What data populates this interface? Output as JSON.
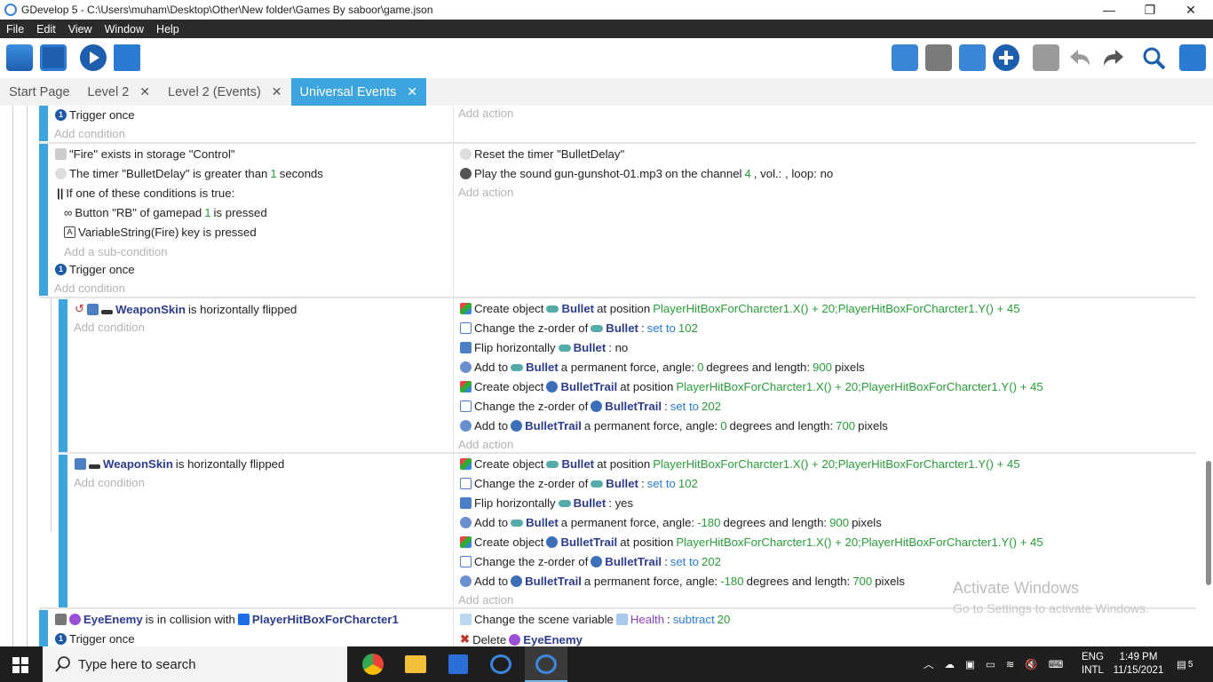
{
  "window": {
    "title": "GDevelop 5 - C:\\Users\\muham\\Desktop\\Other\\New folder\\Games By saboor\\game.json",
    "minimize": "—",
    "restore": "❐",
    "close": "✕"
  },
  "menu": [
    "File",
    "Edit",
    "View",
    "Window",
    "Help"
  ],
  "tabs": [
    {
      "label": "Start Page"
    },
    {
      "label": "Level 2",
      "close": "✕"
    },
    {
      "label": "Level 2 (Events)",
      "close": "✕"
    },
    {
      "label": "Universal Events",
      "close": "✕"
    }
  ],
  "events": {
    "e0": {
      "cond": "Trigger once",
      "add_cond": "Add condition",
      "add_action": "Add action"
    },
    "e1": {
      "c1": "\"Fire\" exists in storage \"Control\"",
      "c2a": "The timer \"BulletDelay\" is greater than",
      "c2n": "1",
      "c2b": "seconds",
      "c3": "If one of these conditions is true:",
      "c4a": "Button \"RB\" of gamepad",
      "c4n": "1",
      "c4b": "is pressed",
      "c5a": "VariableString(Fire)",
      "c5b": "key is pressed",
      "add_sub": "Add a sub-condition",
      "c6": "Trigger once",
      "add_cond": "Add condition",
      "a1": "Reset the timer \"BulletDelay\"",
      "a2a": "Play the sound",
      "a2b": "gun-gunshot-01.mp3",
      "a2c": "on the channel",
      "a2n": "4",
      "a2d": ", vol.: , loop: no",
      "add_action": "Add action"
    },
    "e2": {
      "obj": "WeaponSkin",
      "cond": "is horizontally flipped",
      "add_cond": "Add condition",
      "a1": {
        "t": "Create object",
        "o": "Bullet",
        "p": "at position",
        "v": "PlayerHitBoxForCharcter1.X() + 20;PlayerHitBoxForCharcter1.Y() + 45"
      },
      "a2": {
        "t": "Change the z-order of",
        "o": "Bullet",
        "s": "set to",
        "n": "102"
      },
      "a3": {
        "t": "Flip horizontally",
        "o": "Bullet",
        "v": ": no"
      },
      "a4": {
        "t": "Add to",
        "o": "Bullet",
        "p": "a permanent force, angle:",
        "n1": "0",
        "m": "degrees and length:",
        "n2": "900",
        "e": "pixels"
      },
      "a5": {
        "t": "Create object",
        "o": "BulletTrail",
        "p": "at position",
        "v": "PlayerHitBoxForCharcter1.X() + 20;PlayerHitBoxForCharcter1.Y() + 45"
      },
      "a6": {
        "t": "Change the z-order of",
        "o": "BulletTrail",
        "s": "set to",
        "n": "202"
      },
      "a7": {
        "t": "Add to",
        "o": "BulletTrail",
        "p": "a permanent force, angle:",
        "n1": "0",
        "m": "degrees and length:",
        "n2": "700",
        "e": "pixels"
      },
      "add_action": "Add action"
    },
    "e3": {
      "obj": "WeaponSkin",
      "cond": "is horizontally flipped",
      "add_cond": "Add condition",
      "a1": {
        "t": "Create object",
        "o": "Bullet",
        "p": "at position",
        "v": "PlayerHitBoxForCharcter1.X() + 20;PlayerHitBoxForCharcter1.Y() + 45"
      },
      "a2": {
        "t": "Change the z-order of",
        "o": "Bullet",
        "s": "set to",
        "n": "102"
      },
      "a3": {
        "t": "Flip horizontally",
        "o": "Bullet",
        "v": ": yes"
      },
      "a4": {
        "t": "Add to",
        "o": "Bullet",
        "p": "a permanent force, angle:",
        "n1": "-180",
        "m": "degrees and length:",
        "n2": "900",
        "e": "pixels"
      },
      "a5": {
        "t": "Create object",
        "o": "BulletTrail",
        "p": "at position",
        "v": "PlayerHitBoxForCharcter1.X() + 20;PlayerHitBoxForCharcter1.Y() + 45"
      },
      "a6": {
        "t": "Change the z-order of",
        "o": "BulletTrail",
        "s": "set to",
        "n": "202"
      },
      "a7": {
        "t": "Add to",
        "o": "BulletTrail",
        "p": "a permanent force, angle:",
        "n1": "-180",
        "m": "degrees and length:",
        "n2": "700",
        "e": "pixels"
      },
      "add_action": "Add action"
    },
    "e4": {
      "obj1": "EyeEnemy",
      "mid": "is in collision with",
      "obj2": "PlayerHitBoxForCharcter1",
      "c2": "Trigger once",
      "a1a": "Change the scene variable",
      "a1v": "Health",
      "a1b": ":",
      "a1s": "subtract",
      "a1n": "20",
      "a2a": "Delete",
      "a2o": "EyeEnemy"
    }
  },
  "watermark": {
    "line1": "Activate Windows",
    "line2": "Go to Settings to activate Windows."
  },
  "taskbar": {
    "search_placeholder": "Type here to search",
    "lang1": "ENG",
    "lang2": "INTL",
    "time": "1:49 PM",
    "date": "11/15/2021",
    "notif": "5"
  }
}
